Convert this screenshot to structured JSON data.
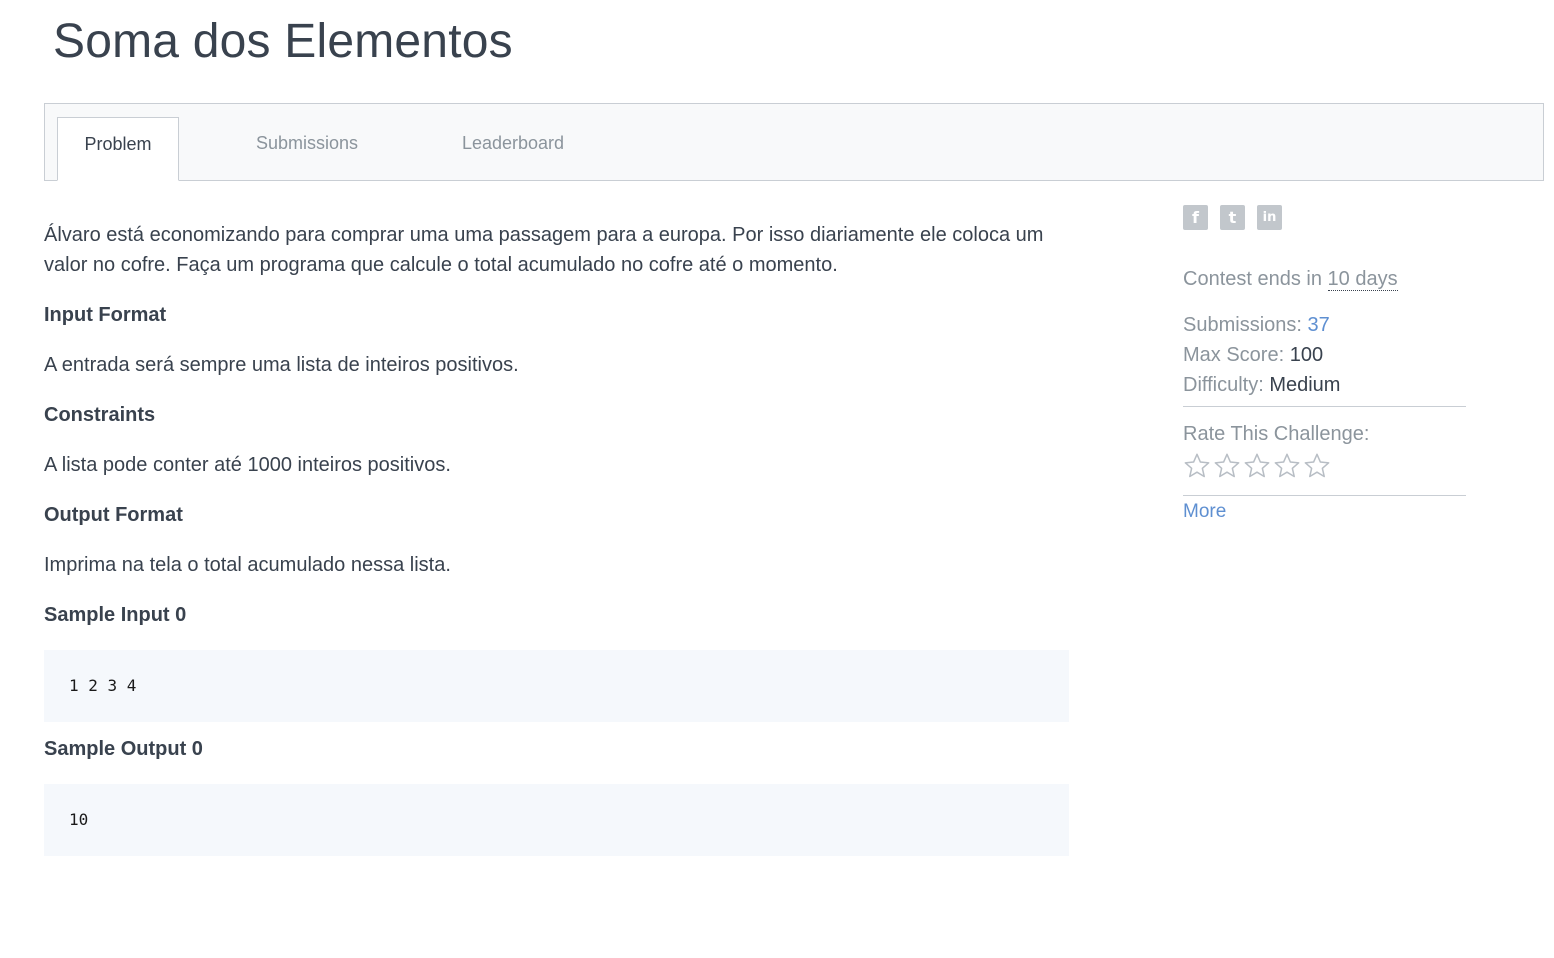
{
  "page": {
    "title": "Soma dos Elementos"
  },
  "tabs": [
    {
      "label": "Problem",
      "active": true
    },
    {
      "label": "Submissions",
      "active": false
    },
    {
      "label": "Leaderboard",
      "active": false
    }
  ],
  "problem": {
    "description": "Álvaro está economizando para comprar uma uma passagem para a europa. Por isso diariamente ele coloca um valor no cofre. Faça um programa que calcule o total acumulado no cofre até o momento.",
    "input_format_heading": "Input Format",
    "input_format_text": "A entrada será sempre uma lista de inteiros positivos.",
    "constraints_heading": "Constraints",
    "constraints_text": "A lista pode conter até 1000 inteiros positivos.",
    "output_format_heading": "Output Format",
    "output_format_text": "Imprima na tela o total acumulado nessa lista.",
    "sample_input_heading": "Sample Input 0",
    "sample_input": "1 2 3 4",
    "sample_output_heading": "Sample Output 0",
    "sample_output": "10"
  },
  "sidebar": {
    "social": {
      "facebook": "f",
      "twitter": "t",
      "linkedin": "in"
    },
    "contest_ends_prefix": "Contest ends in ",
    "contest_ends_value": "10 days",
    "submissions_label": "Submissions: ",
    "submissions_value": "37",
    "max_score_label": "Max Score: ",
    "max_score_value": "100",
    "difficulty_label": "Difficulty: ",
    "difficulty_value": "Medium",
    "rate_label": "Rate This Challenge:",
    "rating": {
      "value": 0,
      "max": 5
    },
    "more_label": "More"
  },
  "colors": {
    "text": "#39424e",
    "muted": "#8b949c",
    "link": "#5e8fd1",
    "code_bg": "#f5f8fc",
    "border": "#c9ced4"
  }
}
